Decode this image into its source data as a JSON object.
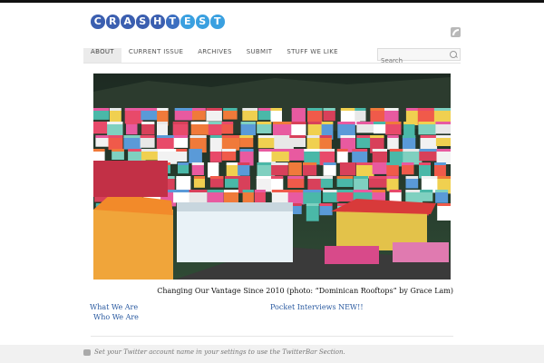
{
  "logo": {
    "letters": [
      "C",
      "R",
      "A",
      "S",
      "H",
      "T",
      "E",
      "S",
      "T"
    ],
    "colors": [
      "#3b5fb0",
      "#3b5fb0",
      "#3b5fb0",
      "#3b5fb0",
      "#3b5fb0",
      "#3b6ec0",
      "#3aa0e0",
      "#3aa0e0",
      "#3aa0e0"
    ]
  },
  "nav": {
    "items": [
      "ABOUT",
      "CURRENT ISSUE",
      "ARCHIVES",
      "SUBMIT",
      "STUFF WE LIKE"
    ],
    "active": "ABOUT"
  },
  "search": {
    "placeholder": "Search"
  },
  "hero": {
    "caption": "Changing Our Vantage Since 2010 (photo: “Dominican Rooftops” by Grace Lam)"
  },
  "links": {
    "what_we_are": "What We Are",
    "who_we_are": "Who We Are",
    "pocket_interviews": "Pocket Interviews NEW!!"
  },
  "footer": {
    "twitter_text": "Set your Twitter account name in your settings to use the TwitterBar Section."
  },
  "icons": [
    "rss-icon",
    "search-icon",
    "twitter-icon"
  ]
}
